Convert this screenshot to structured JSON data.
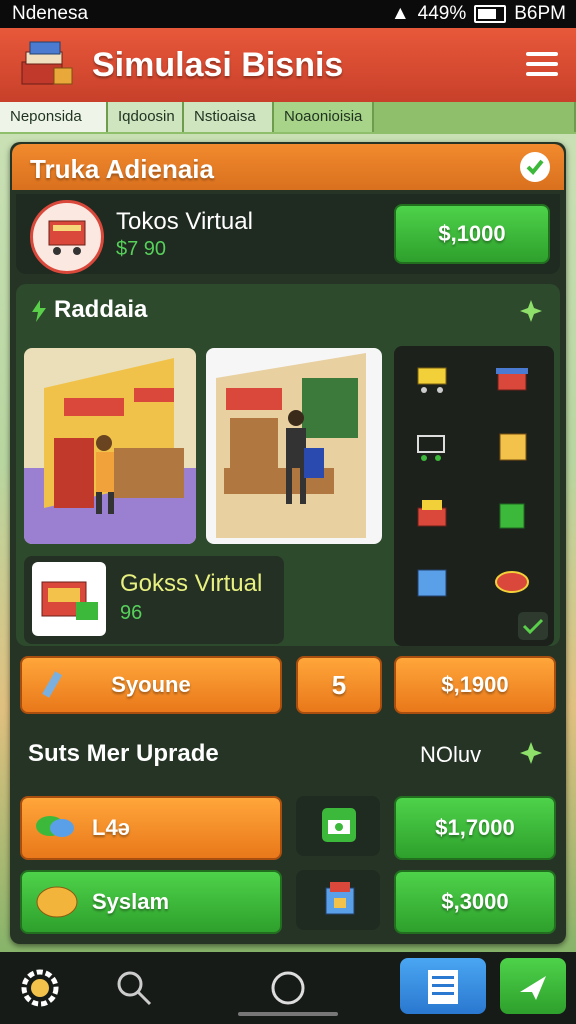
{
  "status_bar": {
    "carrier": "Ndenesa",
    "battery": "449%",
    "time": "B6PM"
  },
  "app": {
    "title": "Simulasi Bisnis"
  },
  "tabs": [
    {
      "label": "Neponsida"
    },
    {
      "label": "Iqdoosin"
    },
    {
      "label": "Nstioaisa"
    },
    {
      "label": "Noaonioisia"
    },
    {
      "label": ""
    }
  ],
  "section_main": {
    "title": "Truka Adienaia",
    "store": {
      "name": "Tokos Virtual",
      "money": "$7 90",
      "price": "$,1000"
    }
  },
  "section_sub": {
    "title": "Raddaia",
    "goods": {
      "name": "Gokss Virtual",
      "value": "96"
    }
  },
  "actions": {
    "action_label": "Syoune",
    "count": "5",
    "price": "$,1900"
  },
  "upgrade": {
    "title": "Suts Mer Uprade",
    "status": "NOluv",
    "items": [
      {
        "label": "L4ə",
        "price": "$1,7000"
      },
      {
        "label": "Syslam",
        "price": "$,3000"
      }
    ]
  },
  "colors": {
    "header_red": "#d9483a",
    "accent_orange": "#f28a2e",
    "accent_green": "#3cb83a",
    "panel_dark": "#263426"
  },
  "icons": [
    "settings-gear-icon",
    "search-icon",
    "home-circle-icon",
    "list-icon",
    "send-icon"
  ]
}
